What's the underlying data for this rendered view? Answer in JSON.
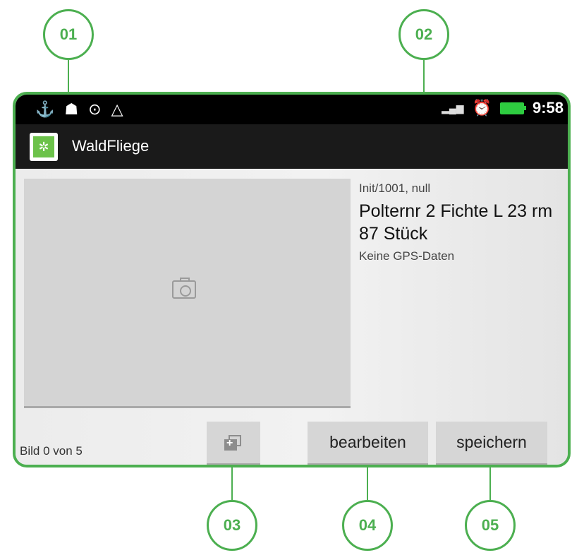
{
  "callouts": [
    "01",
    "02",
    "03",
    "04",
    "05"
  ],
  "status_bar": {
    "left_icons": [
      "usb-icon",
      "android-debug-icon",
      "location-icon",
      "warning-icon"
    ],
    "right_icons": [
      "signal-icon",
      "alarm-icon",
      "battery-icon"
    ],
    "time": "9:58"
  },
  "app_bar": {
    "icon": "waldfliege-logo-icon",
    "title": "WaldFliege"
  },
  "photo": {
    "icon": "camera-icon"
  },
  "info": {
    "id_line": "Init/1001, null",
    "title": "Polternr  2 Fichte L 23 rm 87 Stück",
    "gps": "Keine GPS-Daten"
  },
  "footer": {
    "image_counter": "Bild 0 von 5",
    "add_image_icon": "add-image-icon",
    "edit_label": "bearbeiten",
    "save_label": "speichern"
  },
  "colors": {
    "accent": "#4caf50",
    "status_bar": "#000000",
    "app_bar": "#1a1a1a",
    "button": "#d6d6d6"
  }
}
